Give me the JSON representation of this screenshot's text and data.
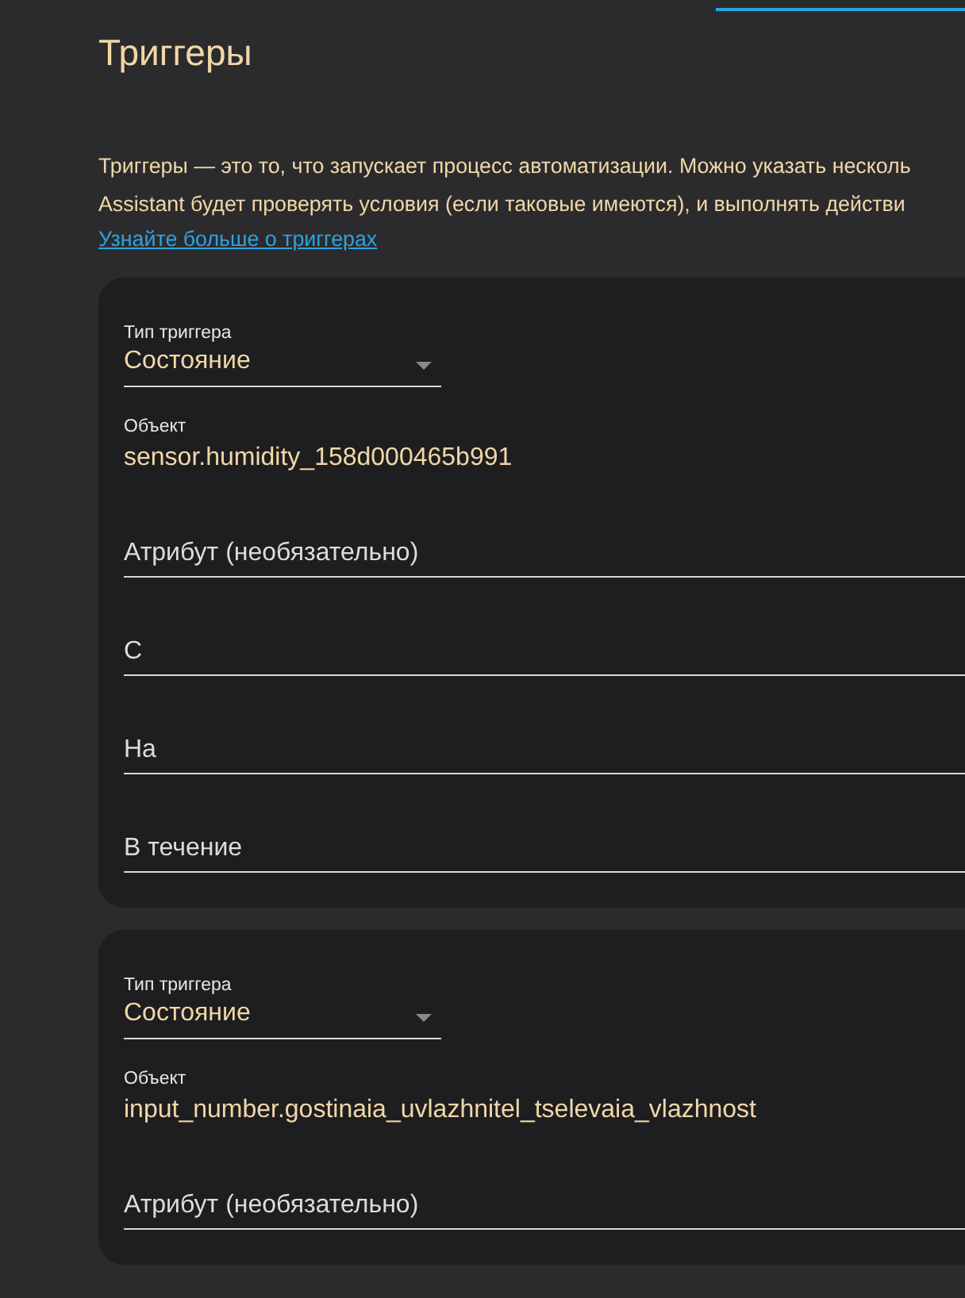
{
  "section": {
    "title": "Триггеры",
    "description_lines": [
      "Триггеры — это то, что запускает процесс автоматизации. Можно указать несколь",
      "Assistant будет проверять условия (если таковые имеются), и выполнять действи"
    ],
    "link": "Узнайте больше о триггерах"
  },
  "triggers": [
    {
      "fields": [
        {
          "kind": "select",
          "label": "Тип триггера",
          "value": "Состояние"
        },
        {
          "kind": "text",
          "label": "Объект",
          "value": "sensor.humidity_158d000465b991"
        },
        {
          "kind": "text",
          "placeholder": "Атрибут (необязательно)"
        },
        {
          "kind": "text",
          "placeholder": "С"
        },
        {
          "kind": "text",
          "placeholder": "На"
        },
        {
          "kind": "text",
          "placeholder": "В течение"
        }
      ]
    },
    {
      "fields": [
        {
          "kind": "select",
          "label": "Тип триггера",
          "value": "Состояние"
        },
        {
          "kind": "text",
          "label": "Объект",
          "value": "input_number.gostinaia_uvlazhnitel_tselevaia_vlazhnost"
        },
        {
          "kind": "text",
          "placeholder": "Атрибут (необязательно)"
        }
      ]
    }
  ]
}
